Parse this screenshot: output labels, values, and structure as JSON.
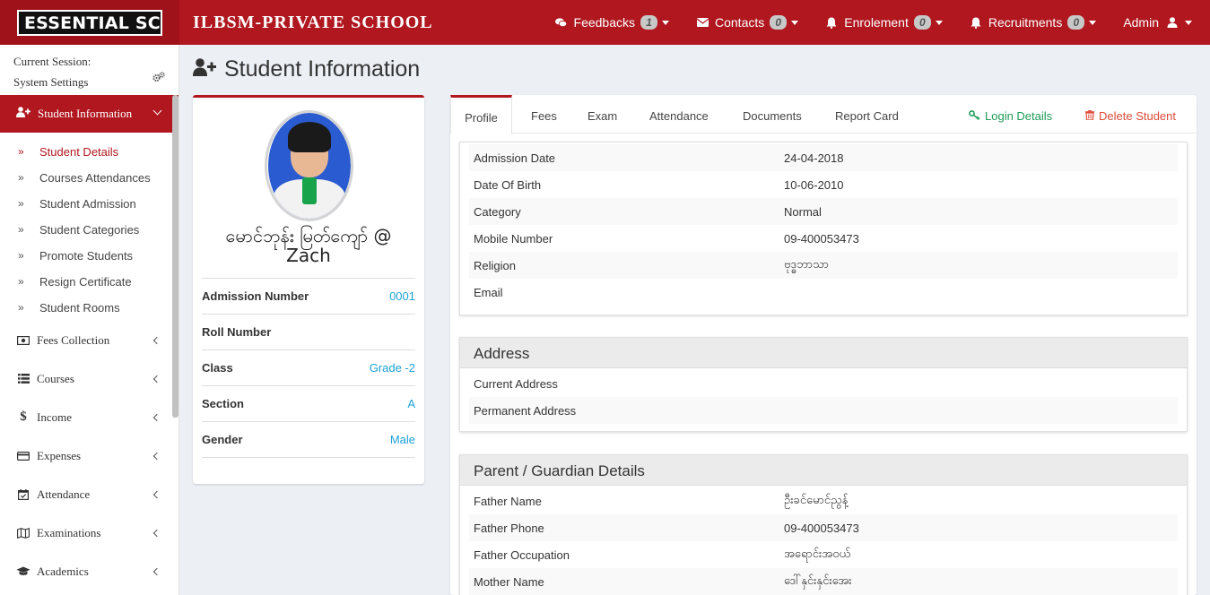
{
  "brand": {
    "logo_text": "ESSENTIAL SCHOOL",
    "school_name": "ILBSM-PRIVATE SCHOOL"
  },
  "topnav": [
    {
      "label": "Feedbacks",
      "badge": "1",
      "icon": "comments-icon"
    },
    {
      "label": "Contacts",
      "badge": "0",
      "icon": "envelope-icon"
    },
    {
      "label": "Enrolement",
      "badge": "0",
      "icon": "bell-icon"
    },
    {
      "label": "Recruitments",
      "badge": "0",
      "icon": "bell-icon"
    },
    {
      "label": "Admin",
      "icon": "user-icon"
    }
  ],
  "sidebar": {
    "session_label": "Current Session:",
    "settings_label": "System Settings",
    "active_menu": "Student Information",
    "submenu": [
      "Student Details",
      "Courses Attendances",
      "Student Admission",
      "Student Categories",
      "Promote Students",
      "Resign Certificate",
      "Student Rooms"
    ],
    "menus": [
      {
        "label": "Fees Collection",
        "icon": "money-icon"
      },
      {
        "label": "Courses",
        "icon": "list-icon"
      },
      {
        "label": "Income",
        "icon": "dollar-icon"
      },
      {
        "label": "Expenses",
        "icon": "credit-card-icon"
      },
      {
        "label": "Attendance",
        "icon": "calendar-check-icon"
      },
      {
        "label": "Examinations",
        "icon": "map-icon"
      },
      {
        "label": "Academics",
        "icon": "graduation-cap-icon"
      }
    ]
  },
  "page_title": "Student Information",
  "profile": {
    "name": "မောင်ဘုန်း မြတ်ကျော် @ Zach",
    "rows": [
      {
        "label": "Admission Number",
        "value": "0001"
      },
      {
        "label": "Roll Number",
        "value": ""
      },
      {
        "label": "Class",
        "value": "Grade -2"
      },
      {
        "label": "Section",
        "value": "A"
      },
      {
        "label": "Gender",
        "value": "Male"
      }
    ]
  },
  "tabs": [
    "Profile",
    "Fees",
    "Exam",
    "Attendance",
    "Documents",
    "Report Card"
  ],
  "actions": {
    "login": "Login Details",
    "delete": "Delete Student"
  },
  "details": [
    {
      "label": "Admission Date",
      "value": "24-04-2018"
    },
    {
      "label": "Date Of Birth",
      "value": "10-06-2010"
    },
    {
      "label": "Category",
      "value": "Normal"
    },
    {
      "label": "Mobile Number",
      "value": "09-400053473"
    },
    {
      "label": "Religion",
      "value": "ဗုဒ္ဓဘာသာ"
    },
    {
      "label": "Email",
      "value": ""
    }
  ],
  "address": {
    "title": "Address",
    "rows": [
      {
        "label": "Current Address",
        "value": ""
      },
      {
        "label": "Permanent Address",
        "value": ""
      }
    ]
  },
  "guardian": {
    "title": "Parent / Guardian Details",
    "rows": [
      {
        "label": "Father Name",
        "value": "ဦးခင်မောင်ညွန့်"
      },
      {
        "label": "Father Phone",
        "value": "09-400053473"
      },
      {
        "label": "Father Occupation",
        "value": "အရောင်းအဝယ်"
      },
      {
        "label": "Mother Name",
        "value": "ဒေါ်နှင်းနှင်းအေး"
      }
    ]
  },
  "colors": {
    "brand_red": "#b0171f",
    "link_blue": "#1ea1d6",
    "green": "#1e9a57",
    "danger": "#dd4b39"
  }
}
